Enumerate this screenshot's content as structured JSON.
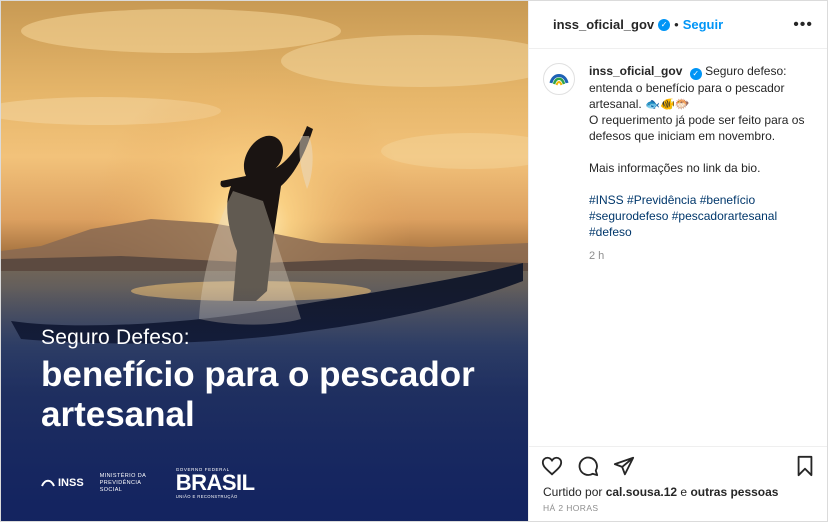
{
  "post": {
    "username": "inss_oficial_gov",
    "follow_label": "Seguir",
    "more_glyph": "•••",
    "image": {
      "small_title": "Seguro Defeso:",
      "big_title": "benefício para o pescador artesanal",
      "logos": {
        "inss": "INSS",
        "ministry": "Ministério da Previdência Social",
        "gov_line": "GOVERNO FEDERAL",
        "brasil": "BRASIL",
        "union": "UNIÃO E RECONSTRUÇÃO"
      }
    },
    "caption": {
      "username": "inss_oficial_gov",
      "line1": "Seguro defeso: entenda o benefício para o pescador artesanal. 🐟🐠🐡",
      "line2": "O requerimento já pode ser feito para os defesos que iniciam em novembro.",
      "line3": "Mais informações no link da bio.",
      "hashtags": [
        "#INSS",
        "#Previdência",
        "#benefício",
        "#segurodefeso",
        "#pescadorartesanal",
        "#defeso"
      ],
      "time": "2 h"
    },
    "likes": {
      "prefix": "Curtido por",
      "user": "cal.sousa.12",
      "middle": "e",
      "suffix": "outras pessoas"
    },
    "timestamp": "HÁ 2 HORAS"
  },
  "icons": [
    "verified-badge",
    "heart-icon",
    "comment-icon",
    "share-icon",
    "bookmark-icon",
    "more-icon"
  ],
  "colors": {
    "accent": "#0095f6",
    "hashtag": "#00376b",
    "muted": "#8e8e8e",
    "text": "#262626"
  }
}
